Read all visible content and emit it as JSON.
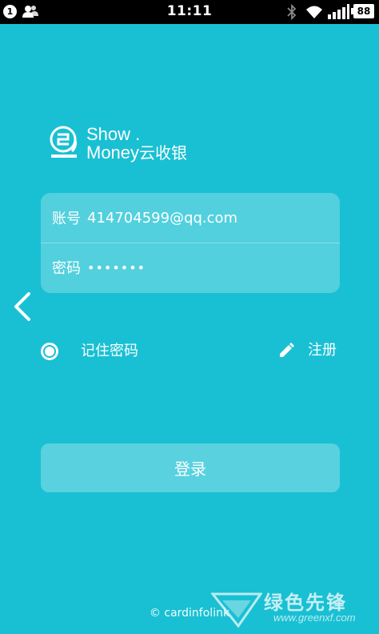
{
  "status_bar": {
    "notification_count": "1",
    "time": "11:11",
    "battery": "88",
    "icons": [
      "contacts-icon",
      "bluetooth-icon",
      "wifi-icon",
      "signal-icon",
      "battery-icon"
    ]
  },
  "logo": {
    "line1": "Show .",
    "line2_latin": "Money",
    "line2_cn": "云收银",
    "icon": "show-money-logo-icon"
  },
  "form": {
    "account_label": "账号",
    "account_value": "414704599@qq.com",
    "password_label": "密码",
    "password_value": "•••••••"
  },
  "options": {
    "remember_label": "记住密码",
    "remember_checked": true,
    "register_label": "注册"
  },
  "login_button": "登录",
  "footer": {
    "copyright": "© cardinfolink"
  },
  "watermark": {
    "text": "绿色先锋",
    "url": "www.greenxf.com"
  },
  "colors": {
    "background": "#19c0d3",
    "status_bar": "#000000",
    "text": "#ffffff"
  }
}
